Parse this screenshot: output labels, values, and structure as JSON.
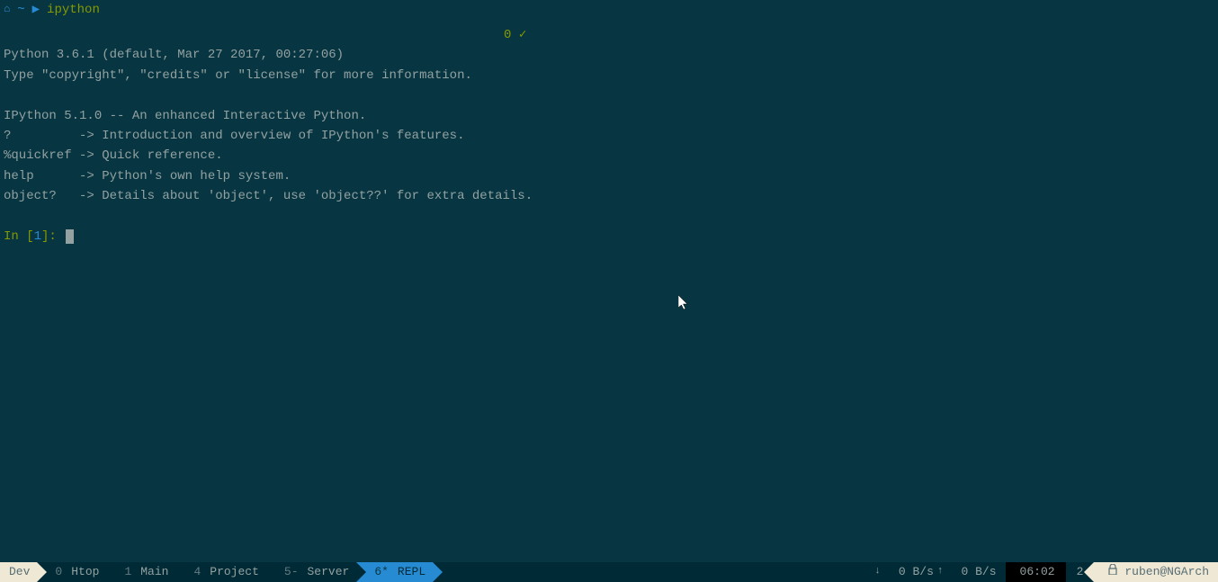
{
  "topbar": {
    "home_icon": "⌂",
    "tilde": "~",
    "arrow": "▶",
    "command": "ipython"
  },
  "status": {
    "count": "0",
    "check": "✓"
  },
  "terminal": {
    "line1": "Python 3.6.1 (default, Mar 27 2017, 00:27:06)",
    "line2": "Type \"copyright\", \"credits\" or \"license\" for more information.",
    "line3": "",
    "line4": "IPython 5.1.0 -- An enhanced Interactive Python.",
    "line5": "?         -> Introduction and overview of IPython's features.",
    "line6": "%quickref -> Quick reference.",
    "line7": "help      -> Python's own help system.",
    "line8": "object?   -> Details about 'object', use 'object??' for extra details.",
    "prompt_in": "In [",
    "prompt_num": "1",
    "prompt_close": "]: "
  },
  "tabs": {
    "session": "Dev",
    "items": [
      {
        "num": "0",
        "label": "Htop"
      },
      {
        "num": "1",
        "label": "Main"
      },
      {
        "num": "4",
        "label": "Project"
      },
      {
        "num": "5-",
        "label": "Server"
      },
      {
        "num": "6*",
        "label": "REPL"
      }
    ]
  },
  "stats": {
    "down_arrow": "↓",
    "net_down": "0 B/s",
    "up_arrow": "↑",
    "net_up": "0 B/s",
    "clock": "06:02",
    "count": "2",
    "lock_icon": "🔒",
    "user": "ruben@NGArch"
  }
}
